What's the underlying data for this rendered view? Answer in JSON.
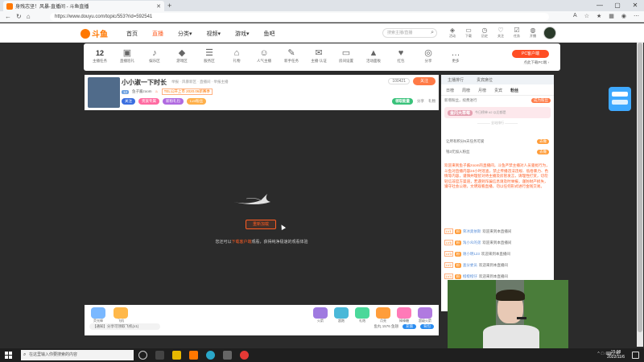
{
  "browser": {
    "tab_title": "身残志坚！风暴-直播间 - 斗鱼直播",
    "url": "https://www.douyu.com/topic/553?rid=592541",
    "win_min": "—",
    "win_max": "▢",
    "win_close": "✕",
    "new_tab": "+"
  },
  "site": {
    "logo": "斗鱼",
    "nav": [
      "首页",
      "直播",
      "分类",
      "视频",
      "游戏",
      "鱼吧"
    ],
    "nav_dropdown": "▾",
    "search_placeholder": "搜索主播/直播",
    "header_icons": [
      "活动",
      "下载",
      "历史",
      "关注",
      "任务",
      "开播"
    ]
  },
  "category_bar": {
    "count": "12",
    "count_label": "主播任务",
    "items": [
      {
        "label": "直播巡礼",
        "icon": "▣"
      },
      {
        "label": "娱乐区",
        "icon": "♪"
      },
      {
        "label": "游戏区",
        "icon": "◆"
      },
      {
        "label": "服务区",
        "icon": "☰"
      },
      {
        "label": "礼物",
        "icon": "⌂"
      },
      {
        "label": "人气主播",
        "icon": "☺"
      },
      {
        "label": "新手任务",
        "icon": "✎"
      },
      {
        "label": "主播·认证",
        "icon": "✉"
      },
      {
        "label": "房间设置",
        "icon": "▭"
      },
      {
        "label": "活动面板",
        "icon": "▲"
      },
      {
        "label": "红包",
        "icon": "♥"
      },
      {
        "label": "分享",
        "icon": "◎"
      },
      {
        "label": "更多",
        "icon": "…"
      }
    ],
    "pc_button": "PC客户端",
    "pc_link": "点此下载PC端 ›"
  },
  "room": {
    "title": "小小淑一下时长",
    "meta": "举报 · 风暴新区 · 直播间 · 举报主播",
    "anchor_name": "鱼子酱zoom",
    "level": "12",
    "promo": "TEL公开上市 2020.06新赛季",
    "badges": [
      "关注",
      "贵族专属",
      "新粉礼包",
      "Lv4粉丝"
    ],
    "viewers": "100421",
    "follow": "关注",
    "energy": "领取能量",
    "actions": [
      "分享",
      "礼物"
    ]
  },
  "video": {
    "retry": "重新加载",
    "message_pre": "您还可以",
    "message_highlight": "下载客户端",
    "message_post": "观看，获得纯净极速的观看体验"
  },
  "giftbar": {
    "left_gifts": [
      "荧光棒",
      "飞机"
    ],
    "right_gifts": [
      "火箭",
      "超跑",
      "礼炮",
      "月亮",
      "棒棒糖",
      "超级火箭"
    ],
    "chip": "【通知】分享可领取飞机(x1)",
    "balance": "鱼丸 1576  鱼翅",
    "recharge": "充值",
    "bag": "背包"
  },
  "chat": {
    "tabs1": [
      "主播排行",
      "贵宾席位"
    ],
    "tabs2": [
      "日榜",
      "周榜",
      "月榜",
      "贵宾",
      "粉丝"
    ],
    "fan_text": "新增粉丝，续费进行",
    "fan_btn": "成为粉丝",
    "rank_pill": "金闪大草莓",
    "rank_sub": "今日榜单 #2 以后都是",
    "divider_note": "———— 全站排行 ————",
    "tasks": [
      {
        "label": "让所有积分5天任务可爱",
        "btn": "去做"
      },
      {
        "label": "钱3元加入粉丝",
        "btn": "去做"
      }
    ],
    "notice": "欢迎来到鱼子酱zoom的直播间，斗鱼严禁主播对人员骚扰行为，斗鱼对直播内容24小时巡查，禁止传播违法违规、低俗暴力、色情等内容，谨慎并理智对待主播及房管发言，请理性打赏，切勿轻信非官方渠道，若遇到诈骗信息请及时举报，谨防财产损失，遵守社会公德，文明观看直播，勿以任何形式进行金钱交易。",
    "messages": [
      {
        "lv": "LV1",
        "medal": "粉",
        "user": "荣冰奥依斯",
        "text": "欢迎来到本直播间"
      },
      {
        "lv": "LV6",
        "medal": "粉",
        "user": "淘小众的弟",
        "text": "欢迎来到本直播间"
      },
      {
        "lv": "LV3",
        "medal": "粉",
        "user": "谢小明123",
        "text": "欢迎来到本直播间"
      },
      {
        "lv": "LV2",
        "medal": "粉",
        "user": "查分委员",
        "text": "欢迎来到本直播间"
      },
      {
        "lv": "LV4",
        "medal": "粉",
        "user": "橙橙橙仔",
        "text": "欢迎来到本直播间"
      }
    ]
  },
  "taskbar": {
    "search": "在这里输入你要搜索的内容",
    "time": "15:08",
    "date": "2022/11/6",
    "tray": "^  ☁  ⌨  ♪  中"
  }
}
